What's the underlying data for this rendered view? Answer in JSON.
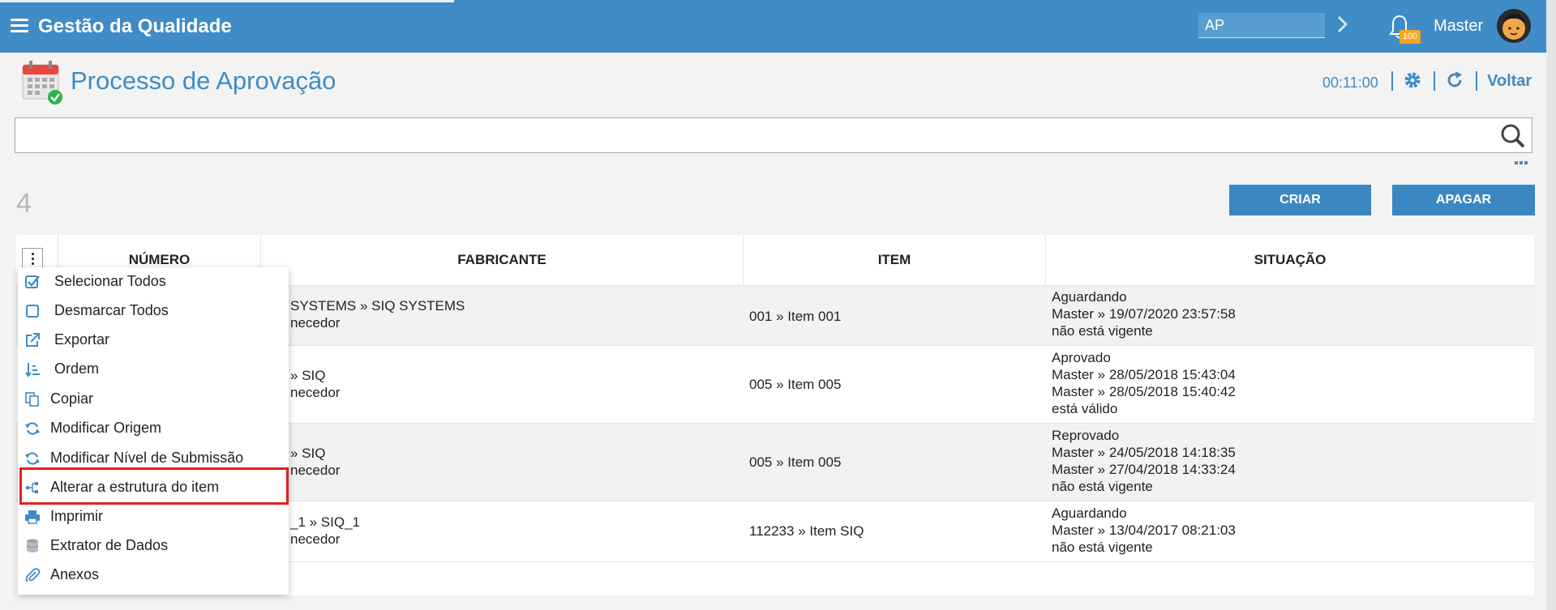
{
  "header": {
    "app_title": "Gestão da Qualidade",
    "search_value": "AP",
    "notification_count": "100",
    "username": "Master",
    "brand_color": "#3f8cc6"
  },
  "page": {
    "title": "Processo de Aprovação",
    "timer": "00:11:00",
    "back_label": "Voltar",
    "search_value": "",
    "record_count": "4"
  },
  "actions": {
    "create_label": "CRIAR",
    "delete_label": "APAGAR"
  },
  "table": {
    "columns": [
      "NÚMERO",
      "FABRICANTE",
      "ITEM",
      "SITUAÇÃO"
    ],
    "rows": [
      {
        "fabricante": [
          "SYSTEMS » SIQ SYSTEMS",
          "necedor"
        ],
        "item": "001 » Item 001",
        "situacao": [
          "Aguardando",
          "Master » 19/07/2020 23:57:58",
          "não está vigente"
        ]
      },
      {
        "fabricante": [
          "» SIQ",
          "necedor"
        ],
        "item": "005 » Item 005",
        "situacao": [
          "Aprovado",
          "Master » 28/05/2018 15:43:04",
          "Master » 28/05/2018 15:40:42",
          "está válido"
        ]
      },
      {
        "fabricante": [
          "» SIQ",
          "necedor"
        ],
        "item": "005 » Item 005",
        "situacao": [
          "Reprovado",
          "Master » 24/05/2018 14:18:35",
          "Master » 27/04/2018 14:33:24",
          "não está vigente"
        ]
      },
      {
        "fabricante": [
          "_1 » SIQ_1",
          "necedor"
        ],
        "item": "112233 » Item SIQ",
        "situacao": [
          "Aguardando",
          "Master » 13/04/2017 08:21:03",
          "não está vigente"
        ]
      }
    ]
  },
  "context_menu": {
    "items": [
      {
        "label": "Selecionar Todos",
        "icon": "checked-box-icon"
      },
      {
        "label": "Desmarcar Todos",
        "icon": "empty-box-icon"
      },
      {
        "label": "Exportar",
        "icon": "external-link-icon"
      },
      {
        "label": "Ordem",
        "icon": "sort-icon"
      },
      {
        "label": "Copiar",
        "icon": "copy-icon"
      },
      {
        "label": "Modificar Origem",
        "icon": "sync-icon"
      },
      {
        "label": "Modificar Nível de Submissão",
        "icon": "sync-icon"
      },
      {
        "label": "Alterar a estrutura do item",
        "icon": "tree-structure-icon"
      },
      {
        "label": "Imprimir",
        "icon": "printer-icon"
      },
      {
        "label": "Extrator de Dados",
        "icon": "database-icon"
      },
      {
        "label": "Anexos",
        "icon": "paperclip-icon"
      }
    ],
    "highlight_color": "#e02020"
  }
}
